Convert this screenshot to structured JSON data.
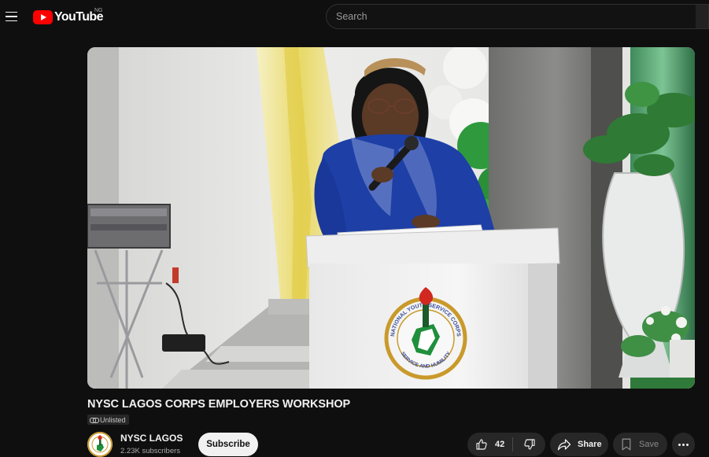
{
  "header": {
    "menu_icon": "hamburger-menu-icon",
    "logo_text": "YouTube",
    "region_code": "NG",
    "search_placeholder": "Search"
  },
  "video": {
    "title": "NYSC LAGOS CORPS EMPLOYERS WORKSHOP",
    "visibility_label": "Unlisted",
    "visibility_icon": "link-icon",
    "frame_text": {
      "emblem_top": "NATIONAL YOUTH SERVICE CORPS",
      "emblem_bottom": "SERVICE AND HUMILITY"
    }
  },
  "channel": {
    "name": "NYSC LAGOS",
    "subscribers": "2.23K subscribers",
    "subscribe_label": "Subscribe"
  },
  "actions": {
    "like_count": "42",
    "like_icon": "thumbs-up-icon",
    "dislike_icon": "thumbs-down-icon",
    "share_label": "Share",
    "share_icon": "share-arrow-icon",
    "save_label": "Save",
    "save_icon": "bookmark-icon",
    "more_icon": "more-horizontal-icon"
  },
  "colors": {
    "background": "#0f0f0f",
    "brand_red": "#ff0000",
    "pill": "#272727",
    "text_primary": "#f1f1f1",
    "text_secondary": "#aaaaaa"
  }
}
